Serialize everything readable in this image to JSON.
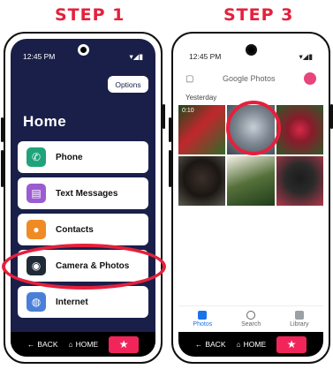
{
  "steps": {
    "left_title": "STEP 1",
    "right_title": "STEP 3"
  },
  "left_phone": {
    "time": "12:45 PM",
    "status_icons": "▾◢▮",
    "options_label": "Options",
    "home_title": "Home",
    "menu": [
      {
        "label": "Phone",
        "icon": "phone-icon",
        "color": "#1fa37a"
      },
      {
        "label": "Text Messages",
        "icon": "message-icon",
        "color": "#9b5bd1"
      },
      {
        "label": "Contacts",
        "icon": "contact-icon",
        "color": "#f08a24"
      },
      {
        "label": "Camera & Photos",
        "icon": "camera-icon",
        "color": "#1f2a36"
      },
      {
        "label": "Internet",
        "icon": "globe-icon",
        "color": "#4a7fd8"
      }
    ],
    "nav": {
      "back": "BACK",
      "home": "HOME"
    }
  },
  "right_phone": {
    "time": "12:45 PM",
    "status_icons": "▾◢▮",
    "app_title": "Google Photos",
    "section_label": "Yesterday",
    "video_duration": "0:10",
    "tabs": [
      {
        "label": "Photos",
        "active": true
      },
      {
        "label": "Search",
        "active": false
      },
      {
        "label": "Library",
        "active": false
      }
    ],
    "nav": {
      "back": "BACK",
      "home": "HOME"
    }
  },
  "colors": {
    "accent": "#e5203c",
    "home_bg": "#1a1f4a",
    "star_button": "#f2255a"
  }
}
